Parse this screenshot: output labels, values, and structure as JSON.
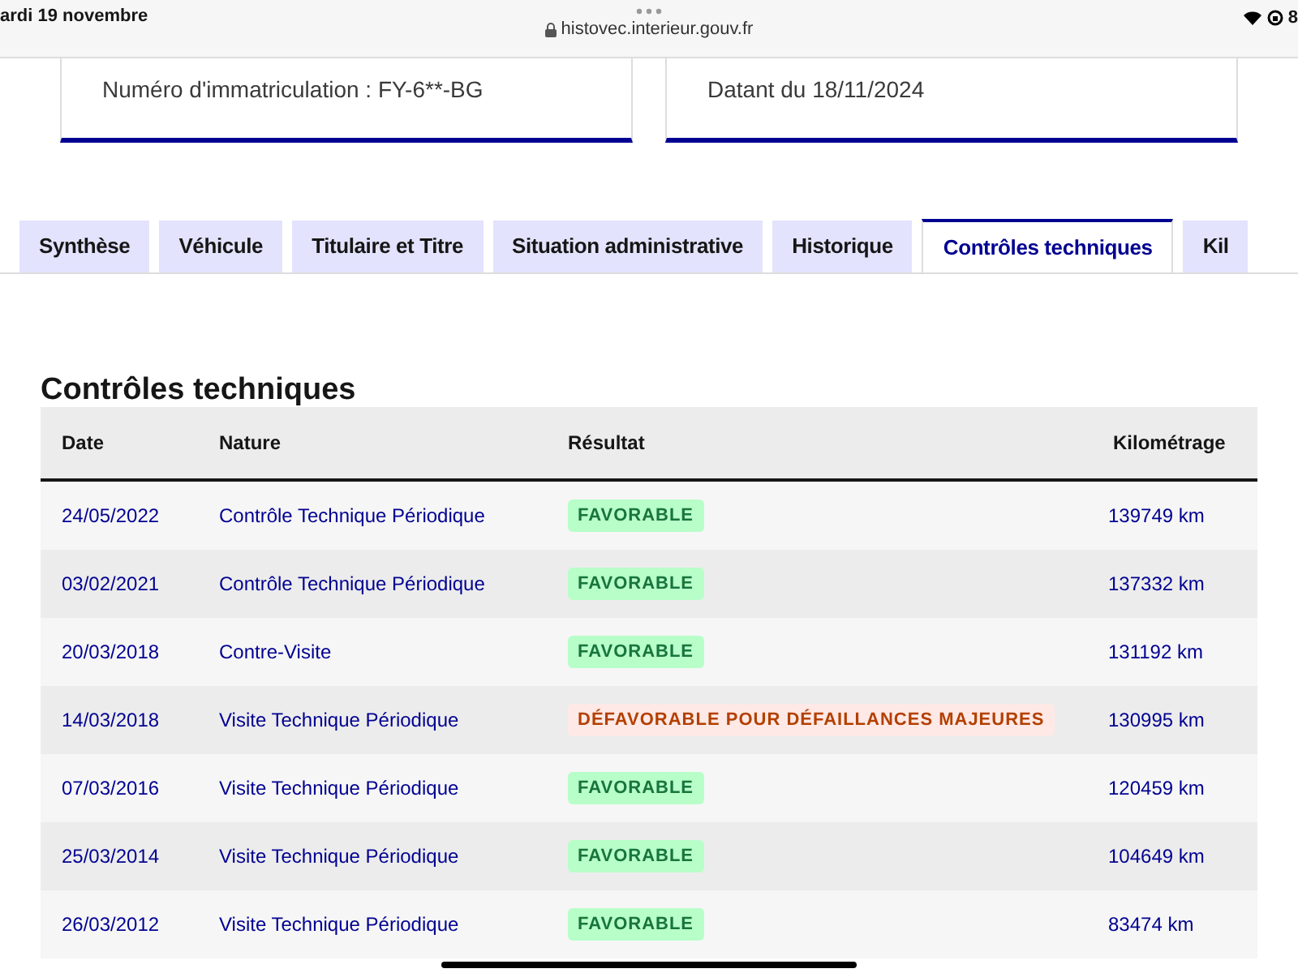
{
  "status_bar": {
    "date": "ardi 19 novembre",
    "url": "histovec.interieur.gouv.fr",
    "battery": "8"
  },
  "cards": [
    {
      "text": "Numéro d'immatriculation : FY-6**-BG"
    },
    {
      "text": "Datant du 18/11/2024"
    }
  ],
  "tabs": [
    {
      "label": "Synthèse",
      "selected": false
    },
    {
      "label": "Véhicule",
      "selected": false
    },
    {
      "label": "Titulaire et Titre",
      "selected": false
    },
    {
      "label": "Situation administrative",
      "selected": false
    },
    {
      "label": "Historique",
      "selected": false
    },
    {
      "label": "Contrôles techniques",
      "selected": true
    },
    {
      "label": "Kil",
      "selected": false
    }
  ],
  "section_title": "Contrôles techniques",
  "table": {
    "columns": [
      "Date",
      "Nature",
      "Résultat",
      "Kilométrage"
    ],
    "rows": [
      {
        "date": "24/05/2022",
        "nature": "Contrôle Technique Périodique",
        "result": "FAVORABLE",
        "kind": "favorable",
        "km": "139749 km"
      },
      {
        "date": "03/02/2021",
        "nature": "Contrôle Technique Périodique",
        "result": "FAVORABLE",
        "kind": "favorable",
        "km": "137332 km"
      },
      {
        "date": "20/03/2018",
        "nature": "Contre-Visite",
        "result": "FAVORABLE",
        "kind": "favorable",
        "km": "131192 km"
      },
      {
        "date": "14/03/2018",
        "nature": "Visite Technique Périodique",
        "result": "DÉFAVORABLE POUR DÉFAILLANCES MAJEURES",
        "kind": "defavorable",
        "km": "130995 km"
      },
      {
        "date": "07/03/2016",
        "nature": "Visite Technique Périodique",
        "result": "FAVORABLE",
        "kind": "favorable",
        "km": "120459 km"
      },
      {
        "date": "25/03/2014",
        "nature": "Visite Technique Périodique",
        "result": "FAVORABLE",
        "kind": "favorable",
        "km": "104649 km"
      },
      {
        "date": "26/03/2012",
        "nature": "Visite Technique Périodique",
        "result": "FAVORABLE",
        "kind": "favorable",
        "km": "83474 km"
      }
    ]
  }
}
